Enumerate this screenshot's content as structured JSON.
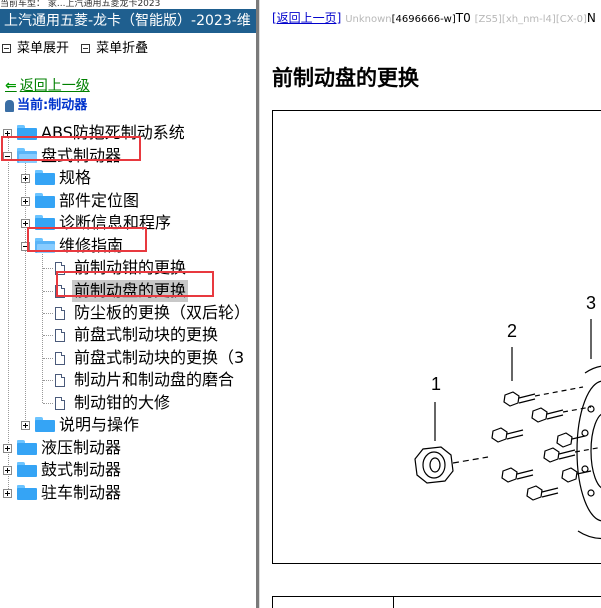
{
  "window": {
    "top_strip": "当前车型：  家...上汽通用五菱龙卡2023",
    "title": "上汽通用五菱-龙卡（智能版）-2023-维"
  },
  "menu": {
    "expand": "菜单展开",
    "collapse": "菜单折叠"
  },
  "nav": {
    "back": "返回上一级",
    "current": "当前:制动器"
  },
  "tree": [
    {
      "label": "ABS防抱死制动系统"
    },
    {
      "label": "盘式制动器"
    },
    {
      "label": "规格"
    },
    {
      "label": "部件定位图"
    },
    {
      "label": "诊断信息和程序"
    },
    {
      "label": "维修指南"
    },
    {
      "label": "前制动钳的更换"
    },
    {
      "label": "前制动盘的更换"
    },
    {
      "label": "防尘板的更换（双后轮）"
    },
    {
      "label": "前盘式制动块的更换"
    },
    {
      "label": "前盘式制动块的更换（3"
    },
    {
      "label": "制动片和制动盘的磨合"
    },
    {
      "label": "制动钳的大修"
    },
    {
      "label": "说明与操作"
    },
    {
      "label": "液压制动器"
    },
    {
      "label": "鼓式制动器"
    },
    {
      "label": "驻车制动器"
    }
  ],
  "content": {
    "back_link": "[返回上一页]",
    "unknown": "Unknown",
    "code": "[4696666-w]",
    "t0": "T0",
    "tags": "[ZS5][xh_nm-l4][CX-0]",
    "tail": "N",
    "title": "前制动盘的更换",
    "callouts": [
      "1",
      "2",
      "3"
    ]
  }
}
